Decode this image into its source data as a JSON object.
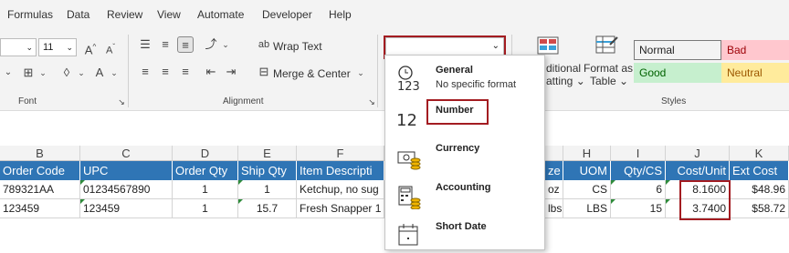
{
  "menu": [
    "Formulas",
    "Data",
    "Review",
    "View",
    "Automate",
    "Developer",
    "Help"
  ],
  "font": {
    "size": "11",
    "grow": "A",
    "shrink": "A",
    "color_a": "A"
  },
  "alignment": {
    "wrap_text": "Wrap Text",
    "merge_center": "Merge & Center"
  },
  "groups": {
    "font": "Font",
    "alignment": "Alignment",
    "styles": "Styles"
  },
  "number_format_box": {
    "value": ""
  },
  "conditional": {
    "line1": "ditional",
    "line2": "atting"
  },
  "format_as_table": {
    "line1": "Format as",
    "line2": "Table"
  },
  "styles": [
    {
      "label": "Normal",
      "bg": "#ffffff",
      "color": "#222222"
    },
    {
      "label": "Bad",
      "bg": "#ffc7ce",
      "color": "#9c0006"
    },
    {
      "label": "Good",
      "bg": "#c6efce",
      "color": "#006100"
    },
    {
      "label": "Neutral",
      "bg": "#ffeb9c",
      "color": "#9c5700"
    }
  ],
  "dropdown": [
    {
      "icon": "clock-123-icon",
      "title": "General",
      "sub": "No specific format"
    },
    {
      "icon": "number-12-icon",
      "title": "Number",
      "sub": ""
    },
    {
      "icon": "currency-icon",
      "title": "Currency",
      "sub": ""
    },
    {
      "icon": "accounting-icon",
      "title": "Accounting",
      "sub": ""
    },
    {
      "icon": "calendar-icon",
      "title": "Short Date",
      "sub": ""
    }
  ],
  "columns": [
    "B",
    "C",
    "D",
    "E",
    "F",
    "H",
    "I",
    "J",
    "K"
  ],
  "headers": {
    "order_code": "Order Code",
    "upc": "UPC",
    "order_qty": "Order Qty",
    "ship_qty": "Ship Qty",
    "item_desc": "Item Descripti",
    "size": "ze",
    "uom": "UOM",
    "qty_cs": "Qty/CS",
    "cost_unit": "Cost/Unit",
    "ext_cost": "Ext Cost"
  },
  "rows": [
    {
      "order_code": "789321AA",
      "upc": "01234567890",
      "order_qty": "1",
      "ship_qty": "1",
      "item_desc": "Ketchup, no sug",
      "size": "oz",
      "uom": "CS",
      "qty_cs": "6",
      "cost_unit": "8.1600",
      "ext_cost": "$48.96"
    },
    {
      "order_code": "123459",
      "upc": "123459",
      "order_qty": "1",
      "ship_qty": "15.7",
      "item_desc": "Fresh Snapper 1",
      "size": "lbs",
      "uom": "LBS",
      "qty_cs": "15",
      "cost_unit": "3.7400",
      "ext_cost": "$58.72"
    }
  ],
  "colors": {
    "header_blue": "#2f75b5",
    "highlight_red": "#a31c21",
    "error_green": "#2e8b3a"
  }
}
